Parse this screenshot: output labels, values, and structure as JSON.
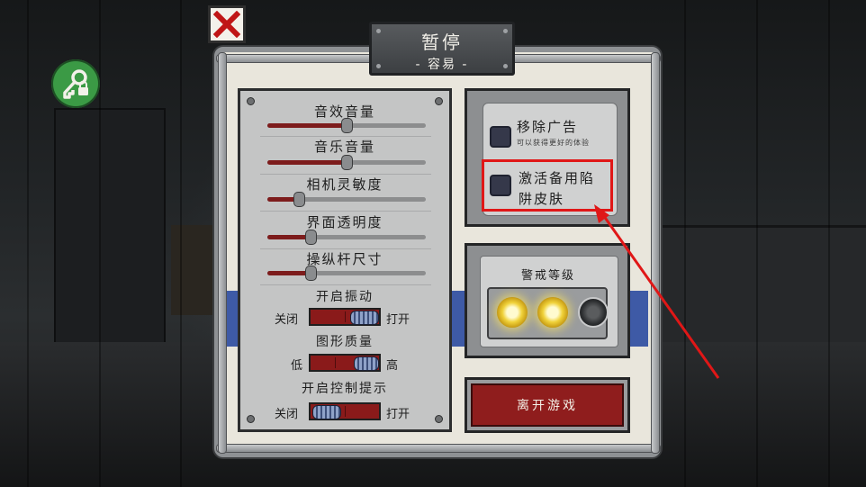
{
  "title": {
    "main": "暂停",
    "difficulty": "- 容易 -"
  },
  "close_icon": "close-icon",
  "key_lock_icon": "key-lock-icon",
  "settings": {
    "sliders": [
      {
        "label": "音效音量",
        "value": 0.5
      },
      {
        "label": "音乐音量",
        "value": 0.5
      },
      {
        "label": "相机灵敏度",
        "value": 0.2
      },
      {
        "label": "界面透明度",
        "value": 0.27
      },
      {
        "label": "操纵杆尺寸",
        "value": 0.27
      }
    ],
    "vibration": {
      "label": "开启振动",
      "off_label": "关闭",
      "on_label": "打开",
      "state": "on"
    },
    "quality": {
      "label": "图形质量",
      "low_label": "低",
      "high_label": "高",
      "state": "high"
    },
    "control_hints": {
      "label": "开启控制提示",
      "off_label": "关闭",
      "on_label": "打开",
      "state": "off"
    }
  },
  "options": {
    "remove_ads": {
      "label": "移除广告",
      "sub": "可以获得更好的体验",
      "checked": false
    },
    "backup_skin": {
      "label_line1": "激活备用陷",
      "label_line2": "阱皮肤",
      "checked": false
    }
  },
  "alert": {
    "title": "警戒等级",
    "lamps": [
      true,
      true,
      false
    ]
  },
  "leave_button": "离开游戏",
  "colors": {
    "accent_red": "#8f1d1d",
    "highlight": "#e01717",
    "band_blue": "#3e5aa6",
    "lamp_on": "#f0d23a"
  }
}
